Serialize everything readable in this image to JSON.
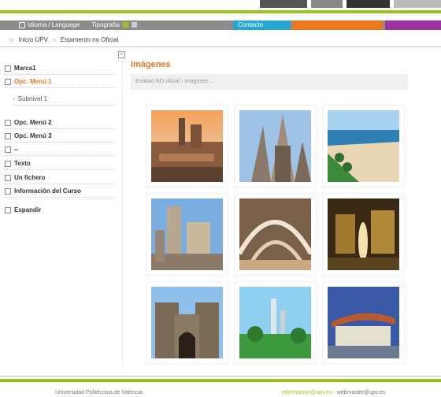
{
  "navbar": {
    "language_label": "Idioma / Language",
    "typography_label": "Tipografía",
    "contact_label": "Contacto",
    "colors": {
      "bar": "#8c8c8c",
      "contact": "#27a6d1",
      "orange": "#ea7a1e",
      "purple": "#9c35a0",
      "green": "#9bc31c"
    }
  },
  "breadcrumb": {
    "home": "Inicio UPV",
    "current": "Estamento no Oficial"
  },
  "sidebar": {
    "items": [
      {
        "label": "Marca1"
      },
      {
        "label": "Opc. Menú 1",
        "active": true
      },
      {
        "label": "Subnivel 1",
        "sub": true
      },
      {
        "label": "Opc. Menú 2"
      },
      {
        "label": "Opc. Menú 3"
      },
      {
        "label": "--"
      },
      {
        "label": "Texto"
      },
      {
        "label": "Un fichero"
      },
      {
        "label": "Información del Curso"
      },
      {
        "label": "Expandir"
      }
    ]
  },
  "main": {
    "title": "Imágenes",
    "info": "Entidad NO oficial › imágenes ..."
  },
  "gallery": {
    "images": [
      {
        "name": "city-rooftops-photo"
      },
      {
        "name": "gothic-facade-photo"
      },
      {
        "name": "beach-promenade-photo"
      },
      {
        "name": "plaza-tower-photo"
      },
      {
        "name": "modern-arches-photo"
      },
      {
        "name": "night-fountain-photo"
      },
      {
        "name": "stone-gate-photo"
      },
      {
        "name": "park-towers-photo"
      },
      {
        "name": "modern-building-photo"
      }
    ]
  },
  "footer": {
    "university": "Universidad Politécnica de Valencia",
    "email_info": "informacion@upv.es",
    "separator": " - ",
    "email_webmaster": "webmaster@upv.es"
  }
}
